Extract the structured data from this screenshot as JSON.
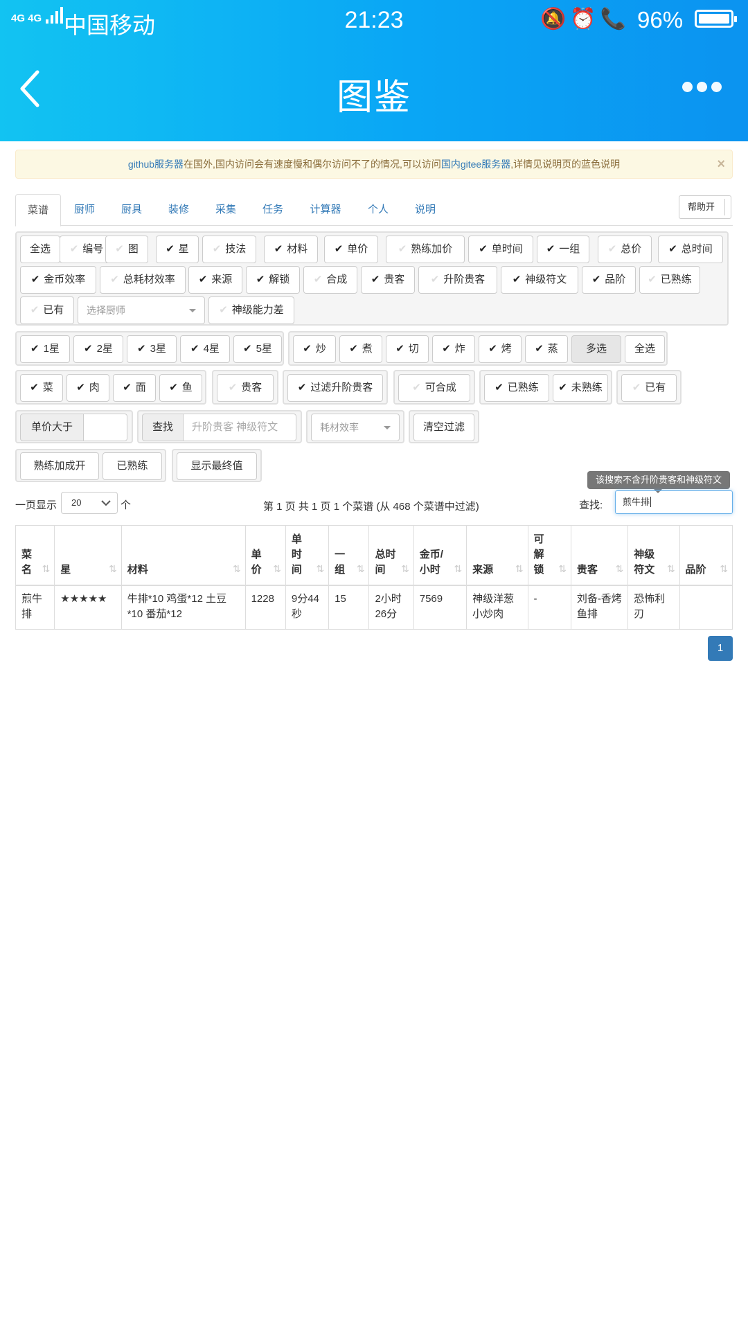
{
  "status": {
    "network": "4G 4G",
    "carrier": "中国移动",
    "time": "21:23",
    "icons": "🔕⏰📞",
    "battery": "96%"
  },
  "header": {
    "title": "图鉴"
  },
  "alert": {
    "link1": "github服务器",
    "text1": "在国外,国内访问会有速度慢和偶尔访问不了的情况,可以访问",
    "link2": "国内gitee服务器",
    "text2": ",详情见说明页的蓝色说明",
    "close": "×"
  },
  "tabs": [
    "菜谱",
    "厨师",
    "厨具",
    "装修",
    "采集",
    "任务",
    "计算器",
    "个人",
    "说明"
  ],
  "help_label": "帮助开",
  "columns_toggle": [
    {
      "label": "全选",
      "checked": null
    },
    {
      "label": "编号",
      "checked": false
    },
    {
      "label": "图",
      "checked": false
    },
    {
      "label": "星",
      "checked": true
    },
    {
      "label": "技法",
      "checked": false
    },
    {
      "label": "材料",
      "checked": true
    },
    {
      "label": "单价",
      "checked": true
    },
    {
      "label": "熟练加价",
      "checked": false
    },
    {
      "label": "单时间",
      "checked": true
    },
    {
      "label": "一组",
      "checked": true
    },
    {
      "label": "总价",
      "checked": false
    },
    {
      "label": "总时间",
      "checked": true
    },
    {
      "label": "金币效率",
      "checked": true
    },
    {
      "label": "总耗材效率",
      "checked": false
    },
    {
      "label": "来源",
      "checked": true
    },
    {
      "label": "解锁",
      "checked": true
    },
    {
      "label": "合成",
      "checked": false
    },
    {
      "label": "贵客",
      "checked": true
    },
    {
      "label": "升阶贵客",
      "checked": false
    },
    {
      "label": "神级符文",
      "checked": true
    },
    {
      "label": "品阶",
      "checked": true
    },
    {
      "label": "已熟练",
      "checked": false
    },
    {
      "label": "已有",
      "checked": false
    },
    {
      "label": "神级能力差",
      "checked": false
    }
  ],
  "chef_select_placeholder": "选择厨师",
  "stars": [
    "1星",
    "2星",
    "3星",
    "4星",
    "5星"
  ],
  "methods": [
    "炒",
    "煮",
    "切",
    "炸",
    "烤",
    "蒸"
  ],
  "multi_label": "多选",
  "all_label": "全选",
  "categories": [
    "菜",
    "肉",
    "面",
    "鱼"
  ],
  "guest_label": "贵客",
  "filter_upgrade_label": "过滤升阶贵客",
  "craftable_label": "可合成",
  "practiced_label": "已熟练",
  "unpracticed_label": "未熟练",
  "owned_label": "已有",
  "price_above_label": "单价大于",
  "search_addon": "查找",
  "search_placeholder": "升阶贵客 神级符文",
  "efficiency_placeholder": "耗材效率",
  "clear_filter_label": "清空过滤",
  "practice_bonus_label": "熟练加成开",
  "practiced2_label": "已熟练",
  "show_final_label": "显示最终值",
  "page_size": {
    "prefix": "一页显示",
    "value": "20",
    "suffix": "个"
  },
  "page_info": "第 1 页 共 1 页 1 个菜谱 (从 468 个菜谱中过滤)",
  "search_label": "查找:",
  "search_value": "煎牛排",
  "tooltip": "该搜索不含升阶贵客和神级符文",
  "table": {
    "headers": [
      "菜名",
      "星",
      "材料",
      "单价",
      "单时间",
      "一组",
      "总时间",
      "金币/小时",
      "来源",
      "可解锁",
      "贵客",
      "神级符文",
      "品阶"
    ],
    "rows": [
      [
        "煎牛排",
        "★★★★★",
        "牛排*10 鸡蛋*12 土豆*10 番茄*12",
        "1228",
        "9分44秒",
        "15",
        "2小时26分",
        "7569",
        "神级洋葱小炒肉",
        "-",
        "刘备-香烤鱼排",
        "恐怖利刃",
        ""
      ]
    ]
  },
  "current_page": "1"
}
